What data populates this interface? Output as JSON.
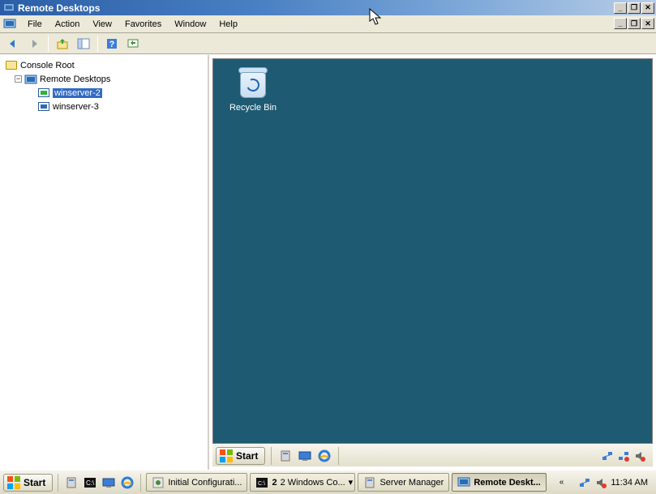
{
  "window": {
    "title": "Remote Desktops"
  },
  "menubar": {
    "items": [
      "File",
      "Action",
      "View",
      "Favorites",
      "Window",
      "Help"
    ]
  },
  "tree": {
    "root": {
      "label": "Console Root"
    },
    "remoteDesktops": {
      "label": "Remote Desktops"
    },
    "servers": [
      {
        "label": "winserver-2",
        "selected": true,
        "connected": true
      },
      {
        "label": "winserver-3",
        "selected": false,
        "connected": false
      }
    ]
  },
  "remote": {
    "desktopIcons": [
      {
        "name": "recycle-bin",
        "label": "Recycle Bin"
      }
    ],
    "start": "Start"
  },
  "host": {
    "start": "Start",
    "tasks": [
      {
        "icon": "config",
        "label": "Initial Configurati..."
      },
      {
        "icon": "cmd",
        "label": "2 Windows Co...",
        "count": "2",
        "dropdown": true
      },
      {
        "icon": "server",
        "label": "Server Manager"
      },
      {
        "icon": "rd",
        "label": "Remote Deskt...",
        "active": true
      }
    ],
    "clock": "11:34 AM"
  }
}
